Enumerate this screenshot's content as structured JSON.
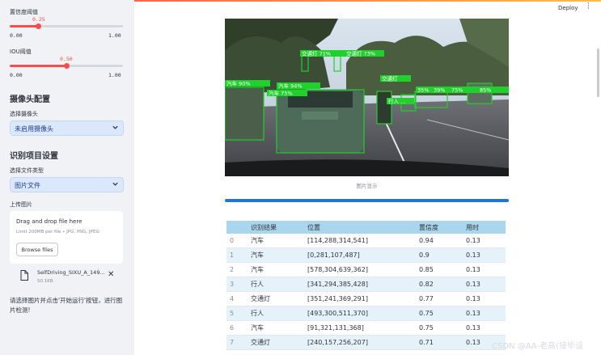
{
  "sidebar": {
    "conf": {
      "label": "置信度阈值",
      "value": "0.25",
      "fraction": 0.25,
      "min": "0.00",
      "max": "1.00"
    },
    "iou": {
      "label": "IOU阈值",
      "value": "0.50",
      "fraction": 0.5,
      "min": "0.00",
      "max": "1.00"
    },
    "camera_section": "摄像头配置",
    "camera_label": "选择摄像头",
    "camera_value": "未启用摄像头",
    "project_section": "识别项目设置",
    "filetype_label": "选择文件类型",
    "filetype_value": "图片文件",
    "upload_label": "上传图片",
    "dropzone_title": "Drag and drop file here",
    "dropzone_sub": "Limit 200MB per file • JPG, PNG, JPEG",
    "browse_label": "Browse files",
    "file_name": "SelfDriving_SIXU_A_149...",
    "file_size": "50.1KB",
    "hint": "请选择图片并点击'开始运行'按钮，进行图片检测!"
  },
  "header": {
    "deploy_label": "Deploy"
  },
  "main": {
    "image_caption": "图片显示",
    "detections": [
      {
        "label": "交通灯 71%",
        "conf": 0.71
      },
      {
        "label": "交通灯 73%",
        "conf": 0.73
      },
      {
        "label": "汽车 90%",
        "conf": 0.9
      },
      {
        "label": "汽车 94%",
        "conf": 0.94
      },
      {
        "label": "汽车 75%",
        "conf": 0.75
      },
      {
        "label": "交通灯",
        "conf": null
      },
      {
        "label": "行人 ...",
        "conf": null
      },
      {
        "label": "35%",
        "conf": 0.35
      },
      {
        "label": "39%",
        "conf": 0.39
      },
      {
        "label": "75%",
        "conf": 0.75
      },
      {
        "label": "85%",
        "conf": 0.85
      }
    ],
    "progress": 1.0,
    "table": {
      "columns": [
        "",
        "识别结果",
        "位置",
        "置信度",
        "用时"
      ],
      "rows": [
        [
          "0",
          "汽车",
          "[114,288,314,541]",
          "0.94",
          "0.13"
        ],
        [
          "1",
          "汽车",
          "[0,281,107,487]",
          "0.9",
          "0.13"
        ],
        [
          "2",
          "汽车",
          "[578,304,639,362]",
          "0.85",
          "0.13"
        ],
        [
          "3",
          "行人",
          "[341,294,385,428]",
          "0.82",
          "0.13"
        ],
        [
          "4",
          "交通灯",
          "[351,241,369,291]",
          "0.77",
          "0.13"
        ],
        [
          "5",
          "行人",
          "[493,300,511,370]",
          "0.75",
          "0.13"
        ],
        [
          "6",
          "汽车",
          "[91,321,131,368]",
          "0.75",
          "0.13"
        ],
        [
          "7",
          "交通灯",
          "[240,157,256,207]",
          "0.71",
          "0.13"
        ]
      ]
    }
  },
  "watermark": "CSDN @AA-老高(接毕设",
  "colors": {
    "accent": "#ff4b4b",
    "select_bg": "#dbe7fb",
    "box": "#1fd12a",
    "progress": "#1f77d0",
    "table_header": "#a9d6ec"
  }
}
